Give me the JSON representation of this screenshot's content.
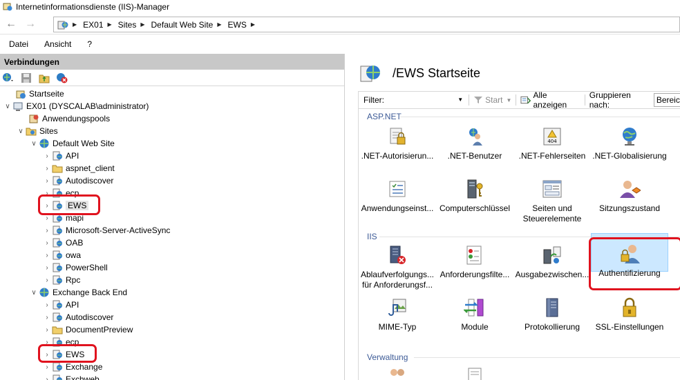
{
  "window": {
    "title": "Internetinformationsdienste (IIS)-Manager"
  },
  "address": {
    "crumbs": [
      "EX01",
      "Sites",
      "Default Web Site",
      "EWS"
    ]
  },
  "menu": {
    "items": [
      "Datei",
      "Ansicht",
      "?"
    ]
  },
  "connections": {
    "header": "Verbindungen",
    "tree": [
      {
        "label": "Startseite",
        "icon": "home-icon"
      },
      {
        "label": "EX01 (DYSCALAB\\administrator)",
        "icon": "server-icon"
      },
      {
        "label": "Anwendungspools",
        "icon": "app-pool-icon"
      },
      {
        "label": "Sites",
        "icon": "sites-folder-icon"
      },
      {
        "label": "Default Web Site",
        "icon": "website-globe-icon"
      },
      {
        "label": "API",
        "icon": "app-icon"
      },
      {
        "label": "aspnet_client",
        "icon": "folder-icon"
      },
      {
        "label": "Autodiscover",
        "icon": "app-icon"
      },
      {
        "label": "ecp",
        "icon": "app-icon"
      },
      {
        "label": "EWS",
        "icon": "app-icon"
      },
      {
        "label": "mapi",
        "icon": "app-icon"
      },
      {
        "label": "Microsoft-Server-ActiveSync",
        "icon": "app-icon"
      },
      {
        "label": "OAB",
        "icon": "app-icon"
      },
      {
        "label": "owa",
        "icon": "app-icon"
      },
      {
        "label": "PowerShell",
        "icon": "app-icon"
      },
      {
        "label": "Rpc",
        "icon": "app-icon"
      },
      {
        "label": "Exchange Back End",
        "icon": "website-globe-icon"
      },
      {
        "label": "API",
        "icon": "app-icon"
      },
      {
        "label": "Autodiscover",
        "icon": "app-icon"
      },
      {
        "label": "DocumentPreview",
        "icon": "folder-icon"
      },
      {
        "label": "ecp",
        "icon": "app-icon"
      },
      {
        "label": "EWS",
        "icon": "app-icon"
      },
      {
        "label": "Exchange",
        "icon": "app-icon"
      },
      {
        "label": "Exchweb",
        "icon": "app-icon"
      }
    ]
  },
  "main": {
    "title": "/EWS Startseite",
    "filter": {
      "label": "Filter:",
      "start": "Start",
      "show_all": "Alle anzeigen",
      "group_by": "Gruppieren nach:",
      "group_value": "Bereich"
    },
    "sections": [
      {
        "label": "ASP.NET",
        "features": [
          {
            "label": ".NET-Autorisierun...",
            "icon": "net-authorization-icon"
          },
          {
            "label": ".NET-Benutzer",
            "icon": "net-users-icon"
          },
          {
            "label": ".NET-Fehlerseiten",
            "icon": "net-error-pages-icon",
            "badge": "404"
          },
          {
            "label": ".NET-Globalisierung",
            "icon": "net-globalization-icon"
          },
          {
            "label": "Anwendungseinst...",
            "icon": "app-settings-icon"
          },
          {
            "label": "Computerschlüssel",
            "icon": "machine-key-icon"
          },
          {
            "label": "Seiten und Steuerelemente",
            "icon": "pages-controls-icon"
          },
          {
            "label": "Sitzungszustand",
            "icon": "session-state-icon"
          }
        ]
      },
      {
        "label": "IIS",
        "features": [
          {
            "label": "Ablaufverfolgungs... für Anforderungsf...",
            "icon": "failed-request-tracing-icon"
          },
          {
            "label": "Anforderungsfilte...",
            "icon": "request-filtering-icon"
          },
          {
            "label": "Ausgabezwischen...",
            "icon": "output-caching-icon"
          },
          {
            "label": "Authentifizierung",
            "icon": "authentication-icon"
          },
          {
            "label": "MIME-Typ",
            "icon": "mime-types-icon"
          },
          {
            "label": "Module",
            "icon": "modules-icon"
          },
          {
            "label": "Protokollierung",
            "icon": "logging-icon"
          },
          {
            "label": "SSL-Einstellungen",
            "icon": "ssl-settings-icon"
          }
        ]
      },
      {
        "label": "Verwaltung",
        "features": []
      }
    ]
  },
  "colors": {
    "highlight_red": "#e0121e",
    "section_blue": "#3c5a96",
    "selection_blue": "#cce8ff"
  }
}
